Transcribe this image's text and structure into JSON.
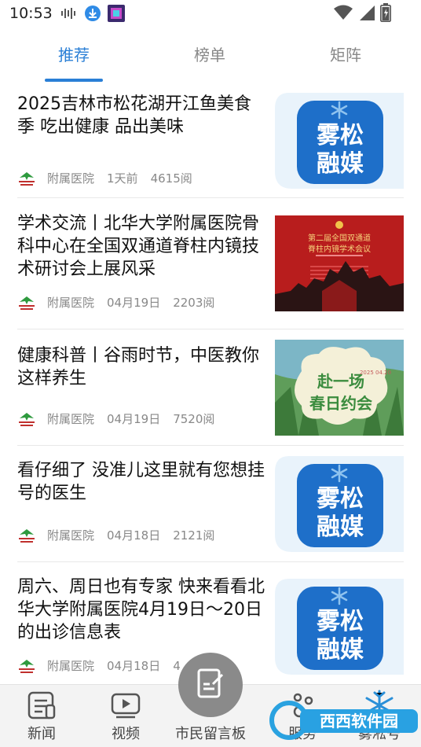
{
  "status": {
    "time": "10:53"
  },
  "tabs": [
    {
      "label": "推荐",
      "active": true
    },
    {
      "label": "榜单",
      "active": false
    },
    {
      "label": "矩阵",
      "active": false
    }
  ],
  "feed": [
    {
      "title": "2025吉林市松花湖开江鱼美食季 吃出健康 品出美味",
      "source": "附属医院",
      "time": "1天前",
      "reads": "4615阅",
      "thumb": "wusong"
    },
    {
      "title": "学术交流丨北华大学附属医院骨科中心在全国双通道脊柱内镜技术研讨会上展风采",
      "source": "附属医院",
      "time": "04月19日",
      "reads": "2203阅",
      "thumb": "conference",
      "thumb_text": {
        "line1": "第二届全国双通道",
        "line2": "脊柱内镜学术会议"
      }
    },
    {
      "title": "健康科普丨谷雨时节，中医教你这样养生",
      "source": "附属医院",
      "time": "04月19日",
      "reads": "7520阅",
      "thumb": "spring",
      "thumb_text": {
        "line1": "赴一场",
        "line2": "春日约会",
        "date": "2025 04.20"
      }
    },
    {
      "title": "看仔细了 没准儿这里就有您想挂号的医生",
      "source": "附属医院",
      "time": "04月18日",
      "reads": "2121阅",
      "thumb": "wusong"
    },
    {
      "title": "周六、周日也有专家 快来看看北华大学附属医院4月19日～20日的出诊信息表",
      "source": "附属医院",
      "time": "04月18日",
      "reads": "4",
      "thumb": "wusong"
    }
  ],
  "wusong_text": {
    "line1": "雾松",
    "line2": "融媒"
  },
  "bottom_nav": [
    {
      "label": "新闻",
      "icon": "news-icon"
    },
    {
      "label": "视频",
      "icon": "video-icon"
    },
    {
      "label": "市民留言板",
      "icon": "edit-icon"
    },
    {
      "label": "服务",
      "icon": "service-icon"
    },
    {
      "label": "雾凇号",
      "icon": "snowflake-icon"
    }
  ],
  "watermark": "西西软件园",
  "colors": {
    "accent": "#2a7fd6",
    "wusong_blue": "#1e6fc9"
  }
}
